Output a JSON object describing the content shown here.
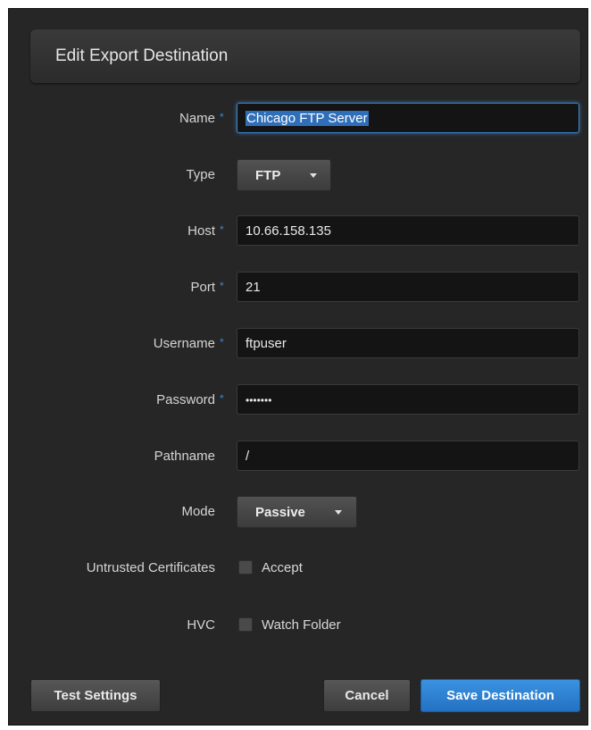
{
  "dialog": {
    "title": "Edit Export Destination"
  },
  "required_marker": "*",
  "fields": {
    "name": {
      "label": "Name",
      "value": "Chicago FTP Server"
    },
    "type": {
      "label": "Type",
      "value": "FTP"
    },
    "host": {
      "label": "Host",
      "value": "10.66.158.135"
    },
    "port": {
      "label": "Port",
      "value": "21"
    },
    "username": {
      "label": "Username",
      "value": "ftpuser"
    },
    "password": {
      "label": "Password",
      "value": "•••••••"
    },
    "pathname": {
      "label": "Pathname",
      "value": "/"
    },
    "mode": {
      "label": "Mode",
      "value": "Passive"
    },
    "untrusted_certificates": {
      "label": "Untrusted Certificates",
      "option_label": "Accept",
      "checked": false
    },
    "hvc": {
      "label": "HVC",
      "option_label": "Watch Folder",
      "checked": false
    }
  },
  "buttons": {
    "test_settings": "Test Settings",
    "cancel": "Cancel",
    "save_destination": "Save Destination"
  },
  "colors": {
    "accent": "#2a7fd0",
    "required_marker": "#3a86d4",
    "dialog_bg": "#262626"
  }
}
